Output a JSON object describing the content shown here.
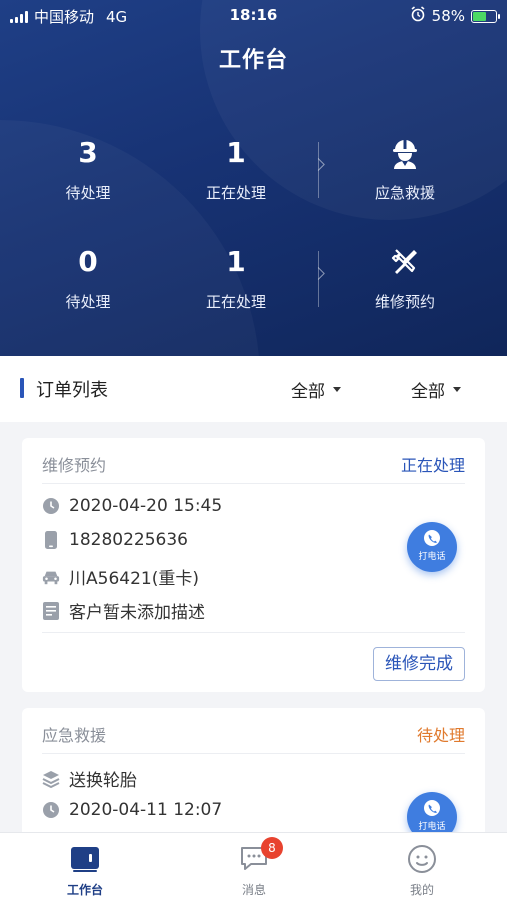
{
  "status_bar": {
    "carrier": "中国移动",
    "network": "4G",
    "time": "18:16",
    "battery": "58%"
  },
  "header": {
    "title": "工作台"
  },
  "stats": {
    "row1": {
      "pending_count": "3",
      "pending_label": "待处理",
      "processing_count": "1",
      "processing_label": "正在处理",
      "action_label": "应急救援",
      "action_icon": "rescue-worker-icon"
    },
    "row2": {
      "pending_count": "0",
      "pending_label": "待处理",
      "processing_count": "1",
      "processing_label": "正在处理",
      "action_label": "维修预约",
      "action_icon": "tools-icon"
    }
  },
  "order_list": {
    "title": "订单列表",
    "filter1": "全部",
    "filter2": "全部"
  },
  "orders": [
    {
      "type": "维修预约",
      "status": "正在处理",
      "status_color": "#2a55b8",
      "datetime": "2020-04-20 15:45",
      "phone": "18280225636",
      "vehicle": "川A56421(重卡)",
      "description": "客户暂未添加描述",
      "call_label": "打电话",
      "action_label": "维修完成"
    },
    {
      "type": "应急救援",
      "status": "待处理",
      "status_color": "#e07a2e",
      "service": "送换轮胎",
      "datetime": "2020-04-11 12:07",
      "call_label": "打电话"
    }
  ],
  "tabbar": {
    "tabs": [
      {
        "label": "工作台",
        "icon": "workbench-icon",
        "active": true
      },
      {
        "label": "消息",
        "icon": "message-icon",
        "badge": "8"
      },
      {
        "label": "我的",
        "icon": "profile-icon"
      }
    ]
  },
  "colors": {
    "header_bg": "#173273",
    "accent": "#2a55b8",
    "call_button": "#3f7de0",
    "pending": "#e07a2e",
    "badge": "#e8432f"
  }
}
